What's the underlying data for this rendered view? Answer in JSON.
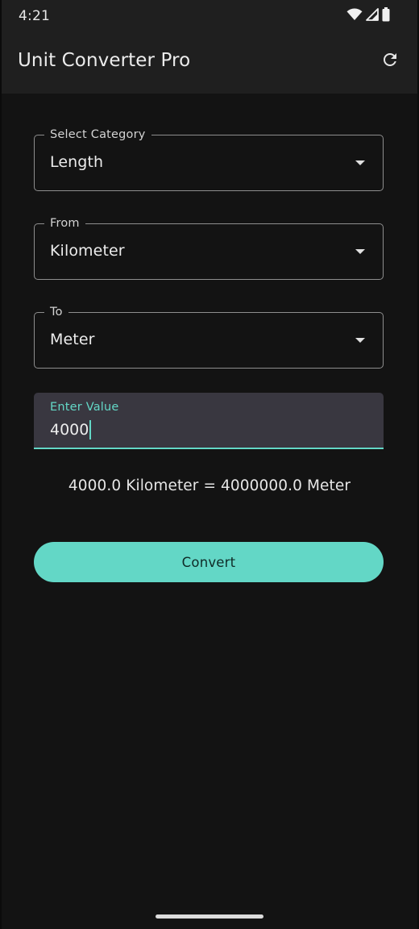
{
  "status_bar": {
    "time": "4:21",
    "icons": [
      "wifi-icon",
      "cellular-signal-icon",
      "battery-icon"
    ]
  },
  "app_bar": {
    "title": "Unit Converter Pro",
    "action_icon": "refresh-icon"
  },
  "fields": {
    "category": {
      "label": "Select Category",
      "value": "Length"
    },
    "from": {
      "label": "From",
      "value": "Kilometer"
    },
    "to": {
      "label": "To",
      "value": "Meter"
    }
  },
  "input": {
    "label": "Enter Value",
    "value": "4000"
  },
  "result": "4000.0 Kilometer = 4000000.0 Meter",
  "convert_button": {
    "label": "Convert"
  },
  "colors": {
    "accent": "#63d7c6",
    "background": "#131313",
    "app_bar": "#1f1f1f",
    "field_fill": "#393740"
  }
}
